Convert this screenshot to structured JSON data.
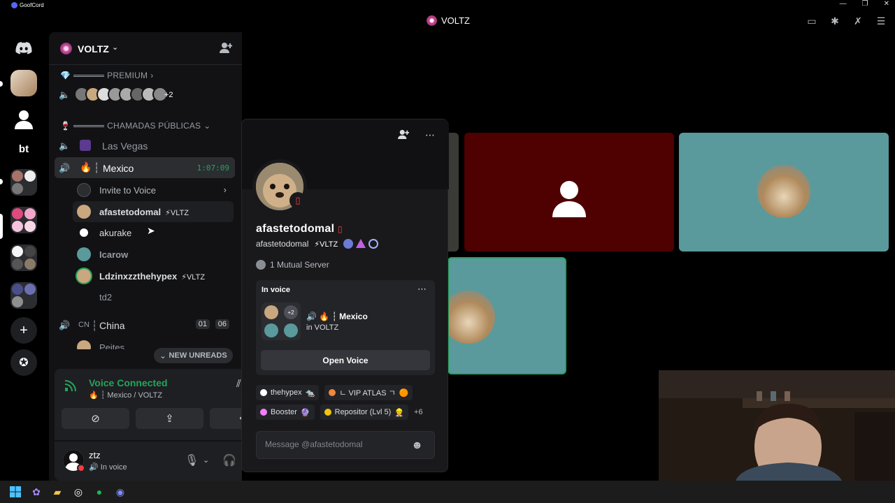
{
  "app": {
    "name": "GoofCord",
    "window_title": "VOLTZ"
  },
  "server": {
    "name": "VOLTZ"
  },
  "categories": [
    {
      "label": "PREMIUM",
      "chevron": "›"
    },
    {
      "label": "CHAMADAS PÚBLICAS",
      "chevron": "⌄"
    }
  ],
  "premium_extra": "+2",
  "guild_labels": {
    "bt": "bt"
  },
  "channels": {
    "las_vegas": "Las Vegas",
    "mexico": "Mexico",
    "mexico_timer": "1:07:09",
    "china_prefix": "CN",
    "china": "China",
    "china_count_a": "01",
    "china_count_b": "06",
    "partial_user": "Peites"
  },
  "invite_to_voice": "Invite to Voice",
  "voice_users": [
    {
      "name": "afastetodomal",
      "tag": "⚡VLTZ"
    },
    {
      "name": "akurake",
      "tag": ""
    },
    {
      "name": "Icarow",
      "tag": ""
    },
    {
      "name": "Ldzinxzzthehypex",
      "tag": "⚡VLTZ"
    },
    {
      "name": "td2",
      "tag": ""
    }
  ],
  "new_unreads": "NEW UNREADS",
  "voice_connected": {
    "title": "Voice Connected",
    "subtitle": "🔥 ┆ Mexico / VOLTZ"
  },
  "user": {
    "name": "ztz",
    "status": "In voice"
  },
  "profile": {
    "display_name": "afastetodomal",
    "username": "afastetodomal",
    "tag": "⚡VLTZ",
    "mutual": "1 Mutual Server",
    "in_voice_label": "In voice",
    "voice_count": "+2",
    "voice_channel": "🔥 ┆ Mexico",
    "voice_server": "in VOLTZ",
    "open_voice": "Open Voice",
    "roles": [
      {
        "name": "thehypex",
        "suffix": "🐀",
        "color": "#ffffff"
      },
      {
        "name": "ㄴ VIP ATLAS ㄱ",
        "suffix": "🟠",
        "color": "#f0883e"
      },
      {
        "name": "Booster",
        "suffix": "🔮",
        "color": "#f47fff"
      },
      {
        "name": "Repositor (Lvl 5)",
        "suffix": "👷",
        "color": "#f1c40f"
      }
    ],
    "roles_more": "+6",
    "message_placeholder": "Message @afastetodomal"
  },
  "colors": {
    "accent_green": "#23a55a",
    "tile_red": "#4f0000",
    "tile_teal": "#5a9a9c"
  }
}
